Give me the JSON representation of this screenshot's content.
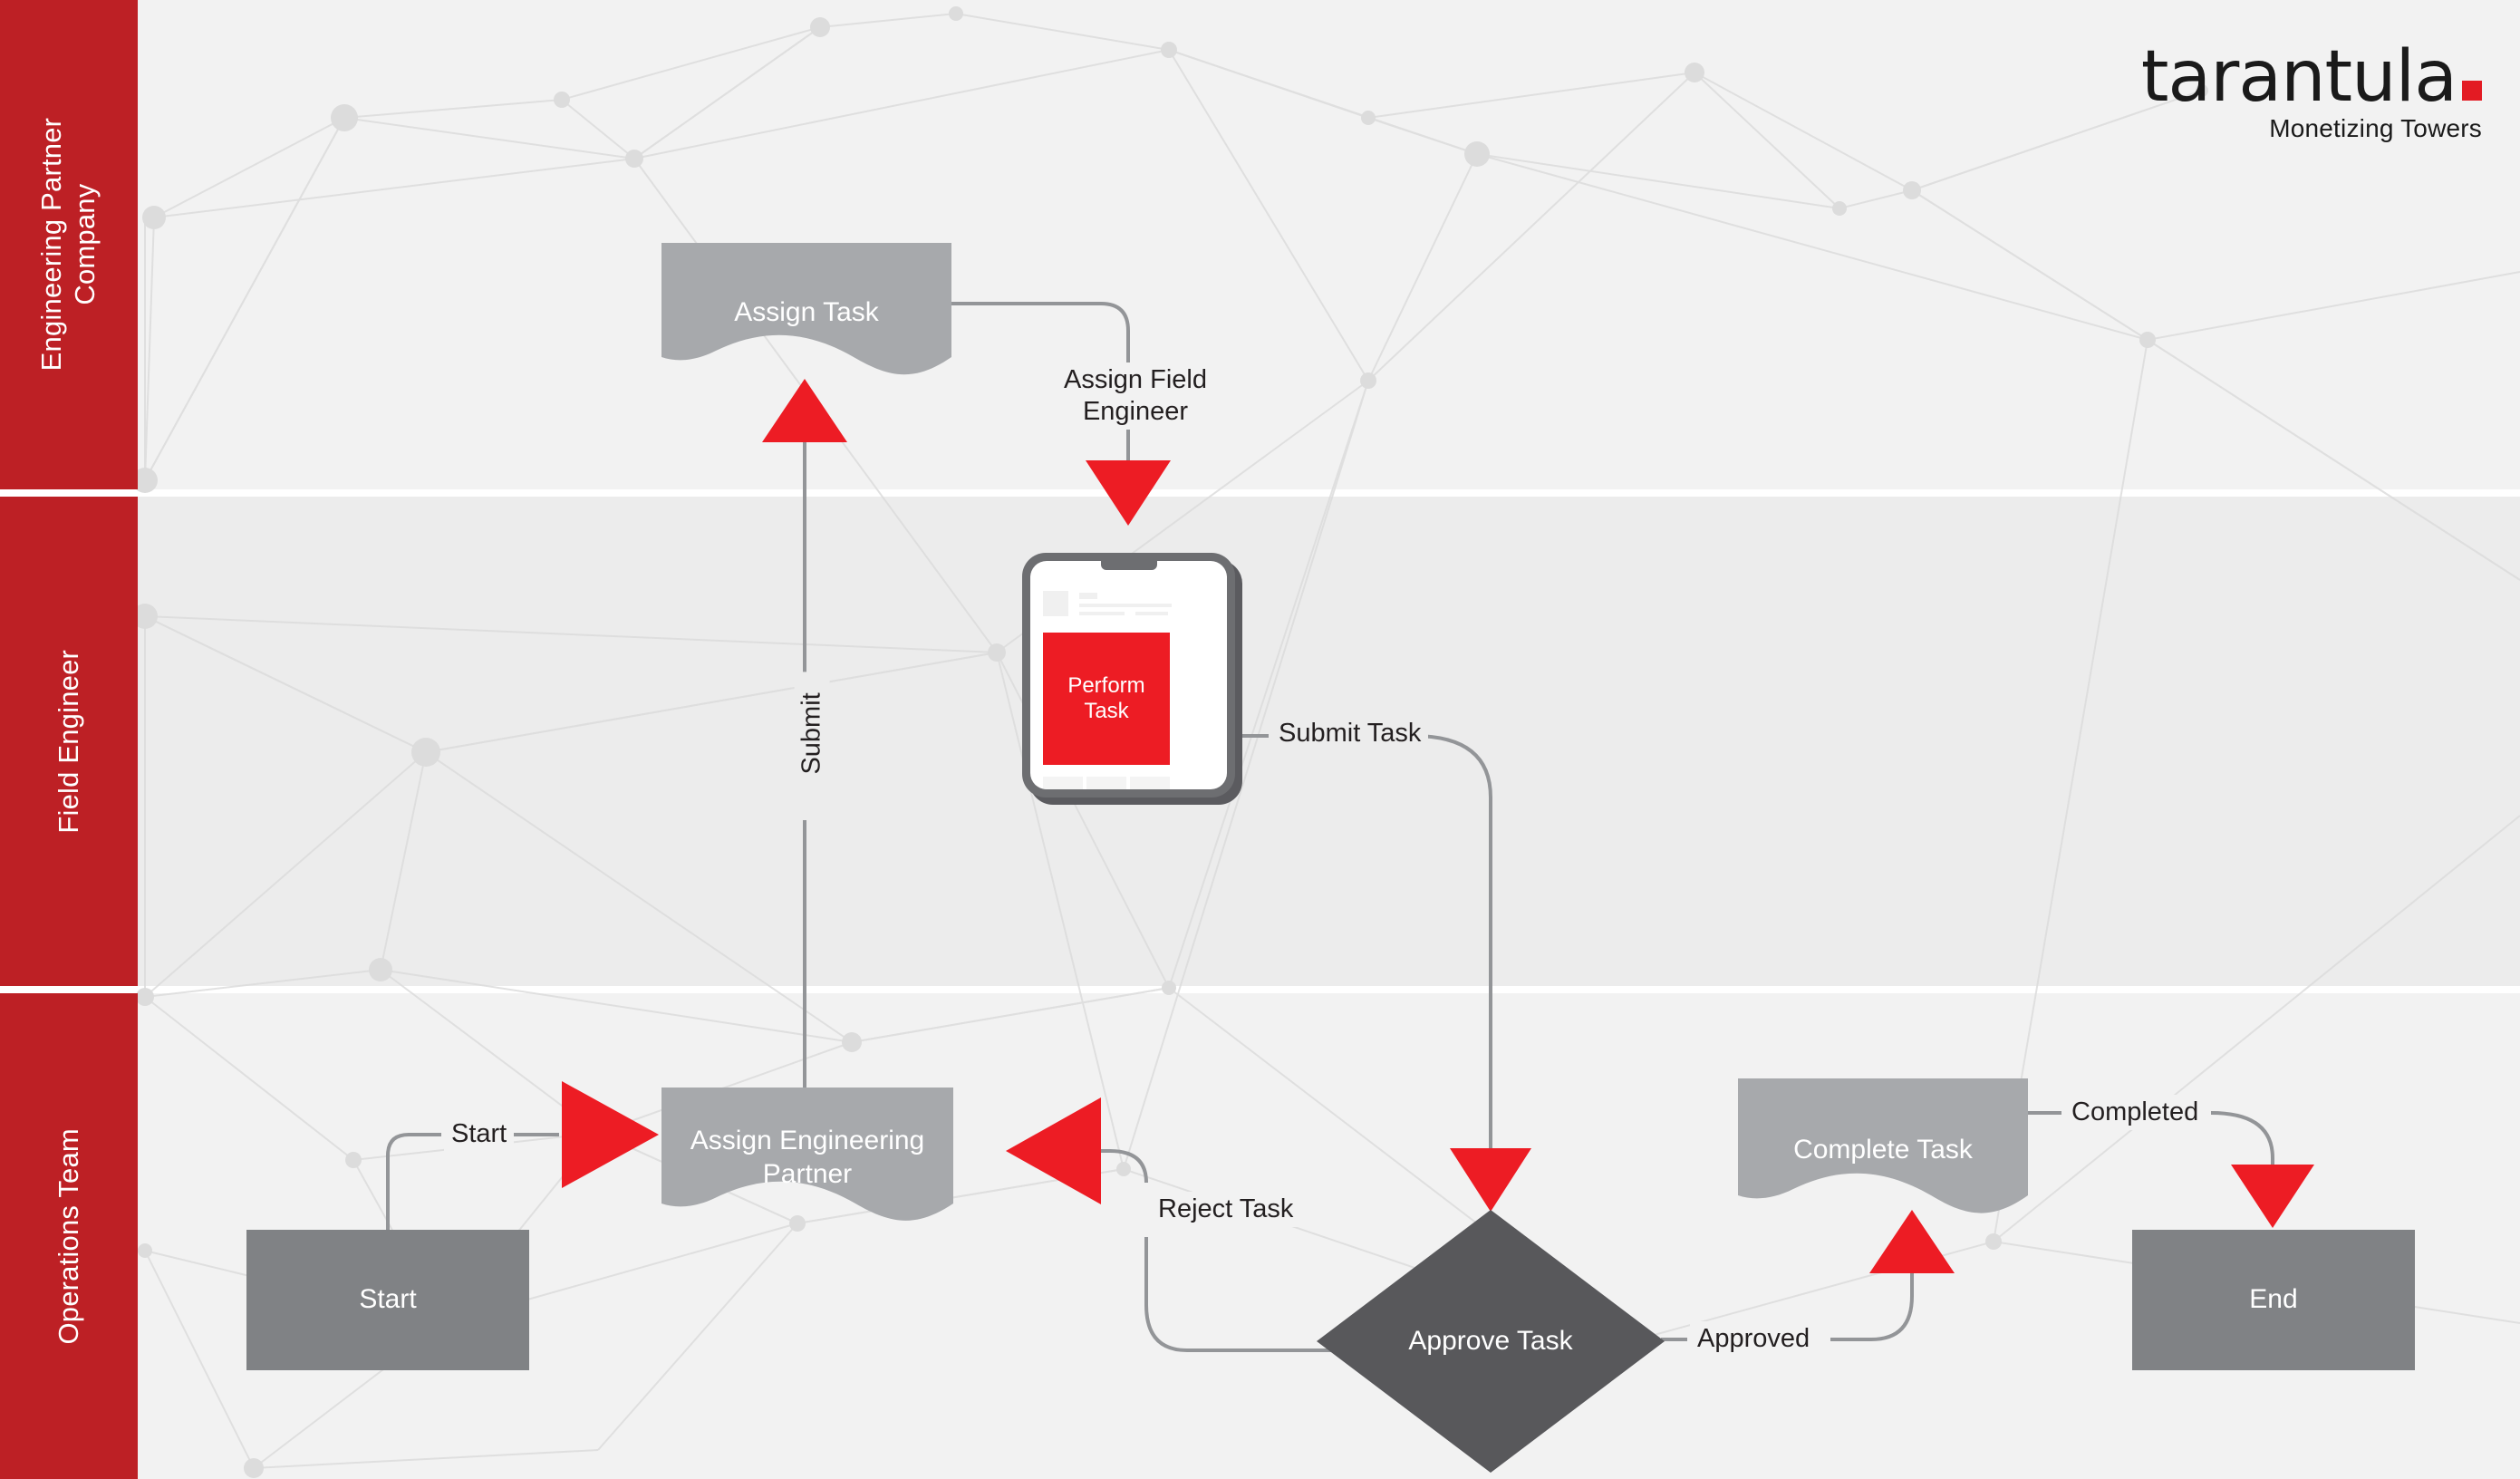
{
  "brand": {
    "logo_word": "tarantula",
    "logo_tagline": "Monetizing Towers",
    "accent_red": "#e31b23",
    "lane_red": "#bd2025",
    "arrow_red": "#ed1c24",
    "node_gray": "#808285",
    "doc_gray": "#a7a9ac",
    "diamond_gray": "#58585b"
  },
  "lanes": [
    {
      "id": "engineering-partner-company",
      "label": "Engineering Partner\nCompany"
    },
    {
      "id": "field-engineer",
      "label": "Field Engineer"
    },
    {
      "id": "operations-team",
      "label": "Operations Team"
    }
  ],
  "lane_labels": {
    "lane1_line1": "Engineering Partner",
    "lane1_line2": "Company",
    "lane2": "Field Engineer",
    "lane3": "Operations Team"
  },
  "nodes": {
    "start": "Start",
    "assign_engineering_partner": "Assign Engineering Partner",
    "assign_task": "Assign Task",
    "perform_task": "Perform Task",
    "approve_task": "Approve Task",
    "complete_task": "Complete Task",
    "end": "End"
  },
  "edge_labels": {
    "start": "Start",
    "assign_field_engineer_l1": "Assign Field",
    "assign_field_engineer_l2": "Engineer",
    "submit": "Submit",
    "submit_task": "Submit Task",
    "reject_task": "Reject Task",
    "approved": "Approved",
    "completed": "Completed"
  },
  "phone": {
    "hero_line1": "Perform",
    "hero_line2": "Task"
  }
}
